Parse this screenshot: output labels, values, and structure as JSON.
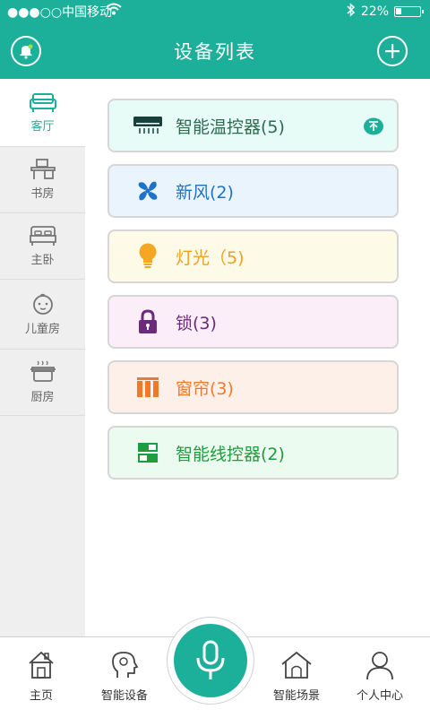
{
  "status_bar": {
    "carrier": "●●●○○中国移动",
    "battery": "22%"
  },
  "header": {
    "title": "设备列表"
  },
  "rooms": [
    {
      "label": "客厅",
      "icon": "sofa-icon",
      "active": true
    },
    {
      "label": "书房",
      "icon": "desk-icon",
      "active": false
    },
    {
      "label": "主卧",
      "icon": "bed-icon",
      "active": false
    },
    {
      "label": "儿童房",
      "icon": "child-face-icon",
      "active": false
    },
    {
      "label": "厨房",
      "icon": "pot-icon",
      "active": false
    }
  ],
  "devices": [
    {
      "label": "智能温控器(5)",
      "icon": "air-conditioner-icon",
      "text_color": "#2d6a4f",
      "bg": "#e7fbf7"
    },
    {
      "label": "新风(2)",
      "icon": "fan-icon",
      "text_color": "#1e73c8",
      "bg": "#eaf4fd"
    },
    {
      "label": "灯光（5)",
      "icon": "light-bulb-icon",
      "text_color": "#f0a020",
      "bg": "#fdfae7"
    },
    {
      "label": "锁(3)",
      "icon": "lock-icon",
      "text_color": "#6b2a7a",
      "bg": "#fbeef8"
    },
    {
      "label": "窗帘(3)",
      "icon": "curtain-icon",
      "text_color": "#f07a2a",
      "bg": "#fdf0e8"
    },
    {
      "label": "智能线控器(2)",
      "icon": "wire-controller-icon",
      "text_color": "#1e9c3e",
      "bg": "#ebfbef"
    }
  ],
  "tabs": [
    {
      "label": "主页",
      "icon": "home-icon"
    },
    {
      "label": "智能设备",
      "icon": "head-gear-icon"
    },
    {
      "label": "智能场景",
      "icon": "house-scene-icon"
    },
    {
      "label": "个人中心",
      "icon": "person-icon"
    }
  ],
  "colors": {
    "accent": "#1cb09a",
    "sidebar_bg": "#efefef"
  }
}
